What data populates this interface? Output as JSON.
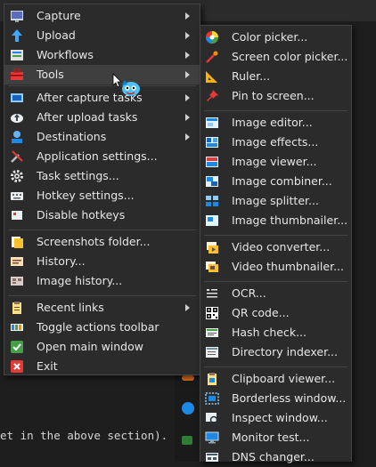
{
  "background": {
    "editor_text": "et in the above section)."
  },
  "main_menu": {
    "items": [
      {
        "label": "Capture",
        "icon": "capture-icon",
        "submenu": true
      },
      {
        "label": "Upload",
        "icon": "upload-arrow-icon",
        "submenu": true
      },
      {
        "label": "Workflows",
        "icon": "workflows-icon",
        "submenu": true
      },
      {
        "label": "Tools",
        "icon": "toolbox-icon",
        "submenu": true,
        "highlighted": true
      },
      {
        "label": "After capture tasks",
        "icon": "after-capture-icon",
        "submenu": true
      },
      {
        "label": "After upload tasks",
        "icon": "after-upload-icon",
        "submenu": true
      },
      {
        "label": "Destinations",
        "icon": "destinations-icon",
        "submenu": true
      },
      {
        "label": "Application settings...",
        "icon": "wrench-screwdriver-icon"
      },
      {
        "label": "Task settings...",
        "icon": "gear-icon"
      },
      {
        "label": "Hotkey settings...",
        "icon": "keyboard-icon"
      },
      {
        "label": "Disable hotkeys",
        "icon": "disable-hotkeys-icon"
      },
      {
        "label": "Screenshots folder...",
        "icon": "folder-icon"
      },
      {
        "label": "History...",
        "icon": "history-icon"
      },
      {
        "label": "Image history...",
        "icon": "image-history-icon"
      },
      {
        "label": "Recent links",
        "icon": "clipboard-icon",
        "submenu": true
      },
      {
        "label": "Toggle actions toolbar",
        "icon": "toolbar-icon"
      },
      {
        "label": "Open main window",
        "icon": "checkmark-icon"
      },
      {
        "label": "Exit",
        "icon": "exit-icon"
      }
    ]
  },
  "tools_submenu": {
    "items": [
      {
        "label": "Color picker...",
        "icon": "color-wheel-icon"
      },
      {
        "label": "Screen color picker...",
        "icon": "eyedropper-icon"
      },
      {
        "label": "Ruler...",
        "icon": "ruler-icon"
      },
      {
        "label": "Pin to screen...",
        "icon": "pin-icon"
      },
      {
        "label": "Image editor...",
        "icon": "image-editor-icon"
      },
      {
        "label": "Image effects...",
        "icon": "image-effects-icon"
      },
      {
        "label": "Image viewer...",
        "icon": "image-viewer-icon"
      },
      {
        "label": "Image combiner...",
        "icon": "image-combiner-icon"
      },
      {
        "label": "Image splitter...",
        "icon": "image-splitter-icon"
      },
      {
        "label": "Image thumbnailer...",
        "icon": "image-thumbnailer-icon"
      },
      {
        "label": "Video converter...",
        "icon": "video-converter-icon"
      },
      {
        "label": "Video thumbnailer...",
        "icon": "video-thumbnailer-icon"
      },
      {
        "label": "OCR...",
        "icon": "ocr-icon"
      },
      {
        "label": "QR code...",
        "icon": "qr-code-icon"
      },
      {
        "label": "Hash check...",
        "icon": "hash-check-icon"
      },
      {
        "label": "Directory indexer...",
        "icon": "directory-indexer-icon"
      },
      {
        "label": "Clipboard viewer...",
        "icon": "clipboard-viewer-icon"
      },
      {
        "label": "Borderless window...",
        "icon": "borderless-window-icon"
      },
      {
        "label": "Inspect window...",
        "icon": "inspect-window-icon"
      },
      {
        "label": "Monitor test...",
        "icon": "monitor-icon"
      },
      {
        "label": "DNS changer...",
        "icon": "dns-icon"
      }
    ]
  }
}
